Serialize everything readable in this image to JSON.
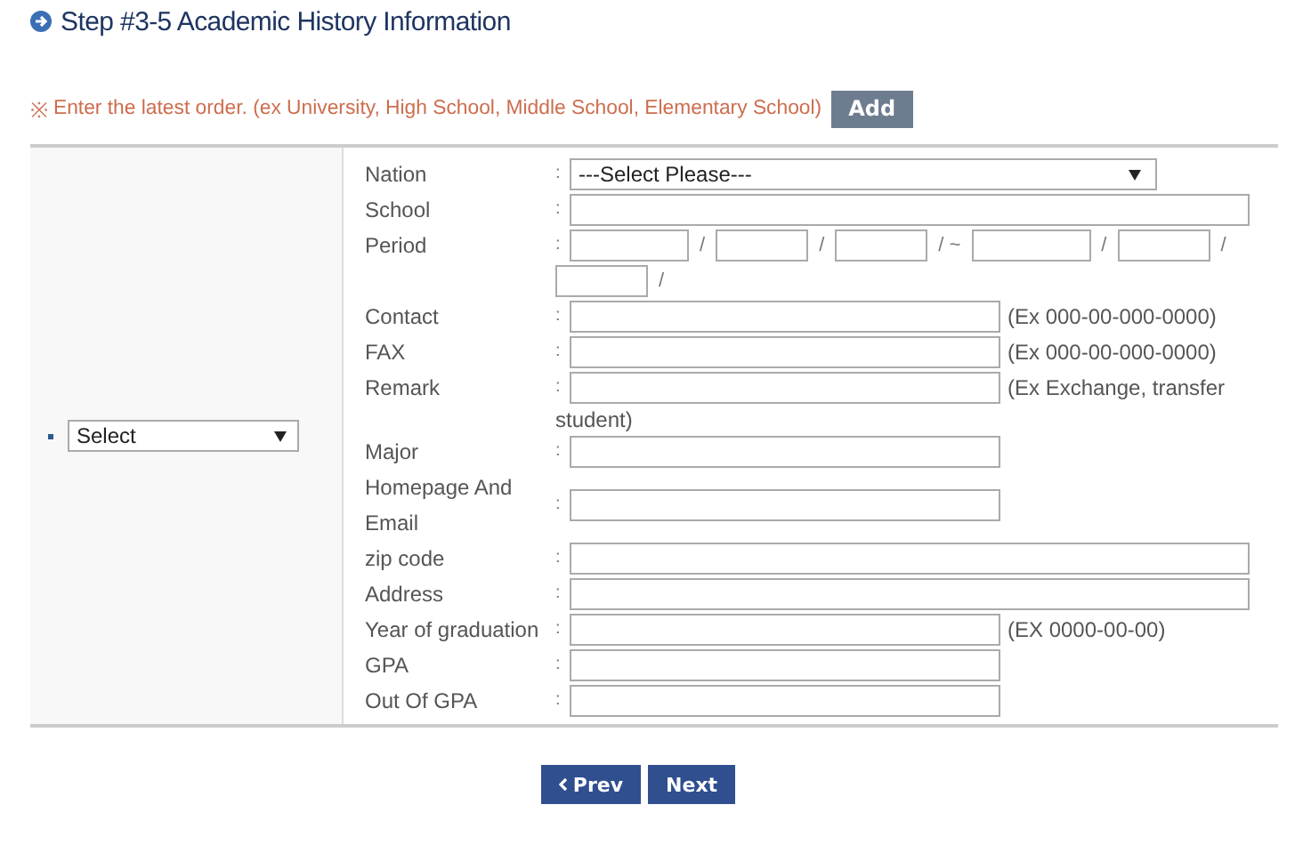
{
  "title": "Step #3-5 Academic History Information",
  "notice": {
    "mark": "※",
    "text": "Enter the latest order. (ex University, High School, Middle School, Elementary School)",
    "button": "Add"
  },
  "entry_select": {
    "value": "Select"
  },
  "colon": ":",
  "fields": [
    {
      "label": "Nation",
      "kind": "select",
      "value": "---Select Please---"
    },
    {
      "label": "School",
      "kind": "long"
    },
    {
      "label": "Period",
      "kind": "period",
      "separators": [
        "/",
        "/",
        "/ ~",
        "/",
        "/",
        "/"
      ]
    },
    {
      "label": "Contact",
      "kind": "medium",
      "hint": "(Ex 000-00-000-0000)"
    },
    {
      "label": "FAX",
      "kind": "medium",
      "hint": "(Ex 000-00-000-0000)"
    },
    {
      "label": "Remark",
      "kind": "medium",
      "hint": "(Ex Exchange, transfer",
      "hint_continued": "student)"
    },
    {
      "label": "Major",
      "kind": "medium"
    },
    {
      "label": "Homepage And Email",
      "kind": "medium"
    },
    {
      "label": "zip code",
      "kind": "long"
    },
    {
      "label": "Address",
      "kind": "long"
    },
    {
      "label": "Year of graduation",
      "kind": "medium",
      "hint": "(EX 0000-00-00)"
    },
    {
      "label": "GPA",
      "kind": "medium"
    },
    {
      "label": "Out Of GPA",
      "kind": "medium"
    }
  ],
  "buttons": [
    {
      "label": "Prev",
      "kind": "prev"
    },
    {
      "label": "Next",
      "kind": "next"
    }
  ]
}
